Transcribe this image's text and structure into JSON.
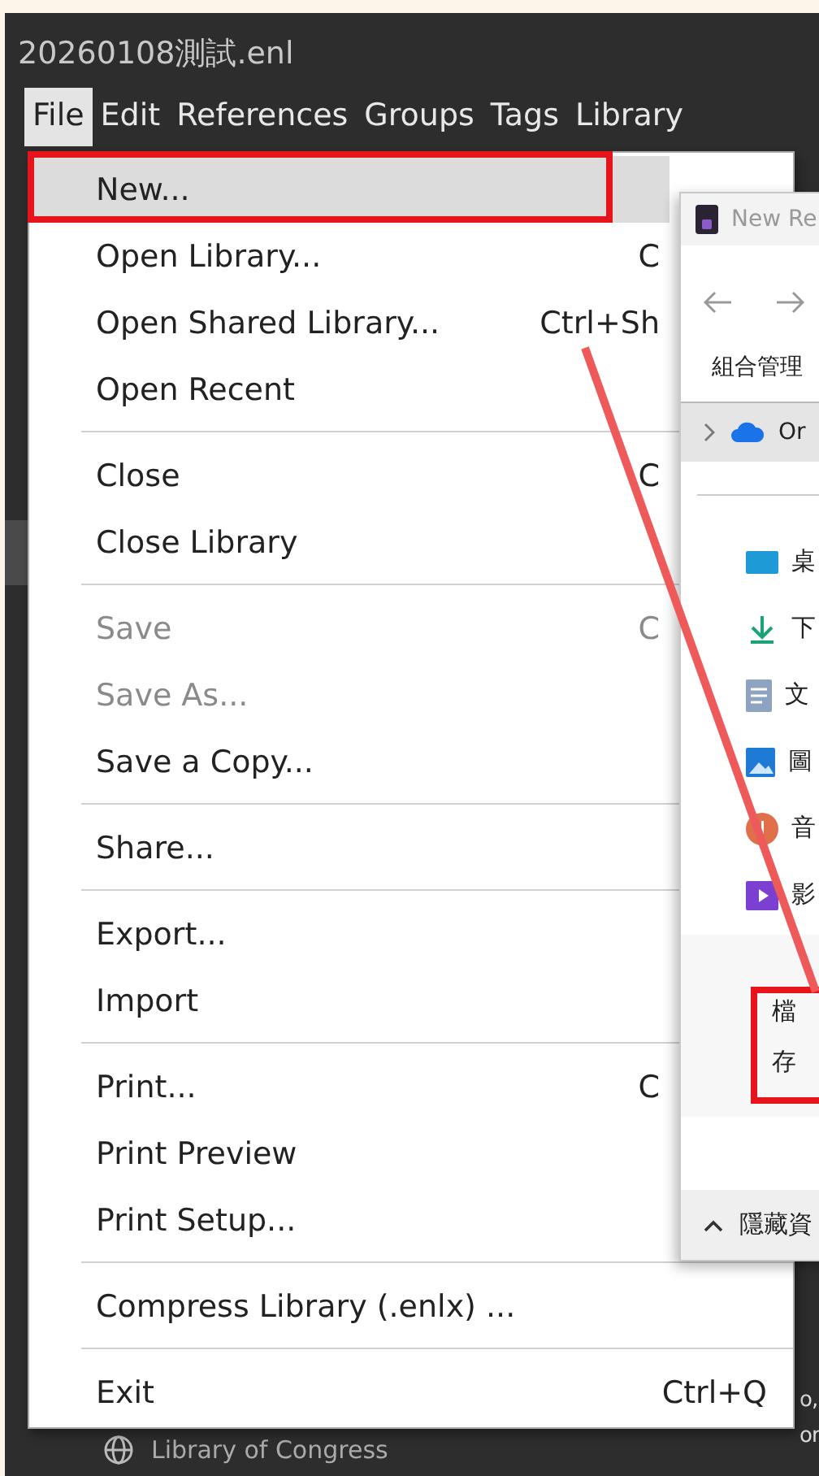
{
  "window": {
    "title": "20260108測試.enl"
  },
  "menubar": [
    {
      "label": "File",
      "selected": true
    },
    {
      "label": "Edit",
      "selected": false
    },
    {
      "label": "References",
      "selected": false
    },
    {
      "label": "Groups",
      "selected": false
    },
    {
      "label": "Tags",
      "selected": false
    },
    {
      "label": "Library",
      "selected": false
    }
  ],
  "file_menu": [
    [
      {
        "label": "New...",
        "selected": true,
        "disabled": false
      },
      {
        "label": "Open Library...",
        "shortcut": "C",
        "selected": false,
        "disabled": false
      },
      {
        "label": "Open Shared Library...",
        "shortcut": "Ctrl+Sh",
        "selected": false,
        "disabled": false
      },
      {
        "label": "Open Recent",
        "selected": false,
        "disabled": false
      }
    ],
    [
      {
        "label": "Close",
        "shortcut": "C",
        "selected": false,
        "disabled": false
      },
      {
        "label": "Close Library",
        "selected": false,
        "disabled": false
      }
    ],
    [
      {
        "label": "Save",
        "shortcut": "C",
        "selected": false,
        "disabled": true
      },
      {
        "label": "Save As...",
        "selected": false,
        "disabled": true
      },
      {
        "label": "Save a Copy...",
        "selected": false,
        "disabled": false
      }
    ],
    [
      {
        "label": "Share...",
        "selected": false,
        "disabled": false
      }
    ],
    [
      {
        "label": "Export...",
        "selected": false,
        "disabled": false
      },
      {
        "label": "Import",
        "selected": false,
        "disabled": false
      }
    ],
    [
      {
        "label": "Print...",
        "shortcut": "C",
        "selected": false,
        "disabled": false
      },
      {
        "label": "Print Preview",
        "selected": false,
        "disabled": false
      },
      {
        "label": "Print Setup...",
        "selected": false,
        "disabled": false
      }
    ],
    [
      {
        "label": "Compress Library (.enlx) ...",
        "selected": false,
        "disabled": false
      }
    ],
    [
      {
        "label": "Exit",
        "shortcut": "Ctrl+Q",
        "selected": false,
        "disabled": false
      }
    ]
  ],
  "background": {
    "bottom_item": "Library of Congress",
    "fragments": [
      "o,",
      "or"
    ]
  },
  "dialog": {
    "title": "New Re",
    "toolbar": "組合管理",
    "nav_row": "Or",
    "places": [
      {
        "label": "桌",
        "kind": "desktop"
      },
      {
        "label": "下",
        "kind": "download"
      },
      {
        "label": "文",
        "kind": "document"
      },
      {
        "label": "圖",
        "kind": "picture"
      },
      {
        "label": "音",
        "kind": "music"
      },
      {
        "label": "影",
        "kind": "video"
      }
    ],
    "fields": [
      "檔",
      "存"
    ],
    "footer": "隱藏資"
  }
}
